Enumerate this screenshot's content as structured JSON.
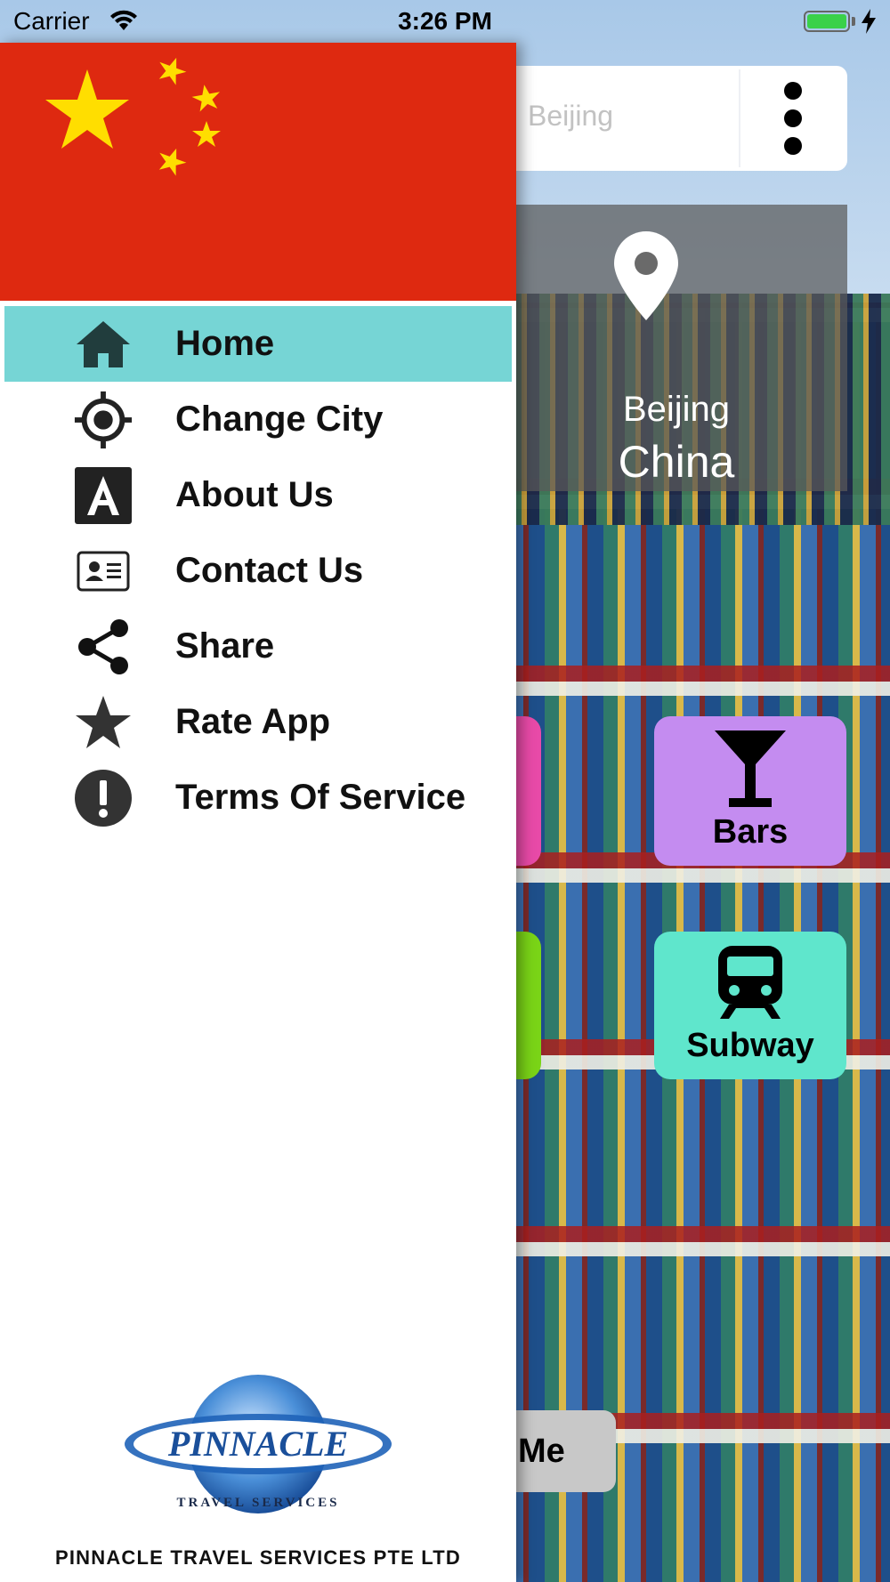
{
  "status_bar": {
    "carrier": "Carrier",
    "time": "3:26 PM",
    "wifi_icon": "wifi-icon",
    "battery_icon": "battery-icon",
    "charging_icon": "charging-bolt-icon"
  },
  "background_app": {
    "search": {
      "value": "Beijing"
    },
    "more_icon": "more-vertical-icon",
    "location": {
      "city": "Beijing",
      "country": "China",
      "icon": "location-pin-icon"
    },
    "tiles": [
      {
        "label": "Bars",
        "icon": "cocktail-glass-icon",
        "color": "#c48cf0"
      },
      {
        "label": "Subway",
        "icon": "subway-train-icon",
        "color": "#5fe6cc"
      }
    ],
    "me_button": {
      "label": "Me"
    }
  },
  "drawer": {
    "header_image": "china-flag",
    "flag_colors": {
      "red": "#de2910",
      "yellow": "#ffde00"
    },
    "active_color": "#76d5d5",
    "menu": [
      {
        "label": "Home",
        "icon": "home-icon",
        "active": true
      },
      {
        "label": "Change City",
        "icon": "crosshair-icon",
        "active": false
      },
      {
        "label": "About Us",
        "icon": "letter-a-icon",
        "active": false
      },
      {
        "label": "Contact Us",
        "icon": "contact-card-icon",
        "active": false
      },
      {
        "label": "Share",
        "icon": "share-icon",
        "active": false
      },
      {
        "label": "Rate App",
        "icon": "star-icon",
        "active": false
      },
      {
        "label": "Terms Of Service",
        "icon": "exclamation-circle-icon",
        "active": false
      }
    ],
    "logo": {
      "name": "pinnacle-logo",
      "text": "PINNACLE",
      "tagline": "TRAVEL SERVICES"
    },
    "company_name": "PINNACLE TRAVEL SERVICES PTE LTD"
  }
}
